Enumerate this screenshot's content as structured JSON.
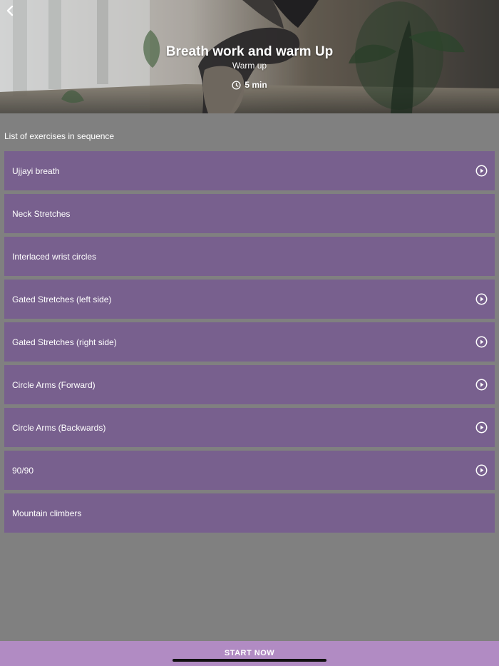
{
  "header": {
    "title": "Breath work and warm Up",
    "subtitle": "Warm up",
    "duration": "5 min",
    "back_icon": "chevron-left-icon",
    "clock_icon": "clock-icon"
  },
  "content": {
    "section_title": "List of exercises in sequence",
    "exercises": [
      {
        "label": "Ujjayi breath",
        "has_video": true
      },
      {
        "label": "Neck Stretches",
        "has_video": false
      },
      {
        "label": "Interlaced wrist circles",
        "has_video": false
      },
      {
        "label": "Gated Stretches (left side)",
        "has_video": true
      },
      {
        "label": "Gated Stretches (right side)",
        "has_video": true
      },
      {
        "label": "Circle Arms (Forward)",
        "has_video": true
      },
      {
        "label": "Circle Arms (Backwards)",
        "has_video": true
      },
      {
        "label": "90/90",
        "has_video": true
      },
      {
        "label": "Mountain climbers",
        "has_video": false
      }
    ]
  },
  "footer": {
    "start_label": "START NOW"
  },
  "colors": {
    "background": "#808080",
    "exercise_row": "#78608e",
    "start_button": "#b18bc3",
    "text": "#ffffff"
  }
}
